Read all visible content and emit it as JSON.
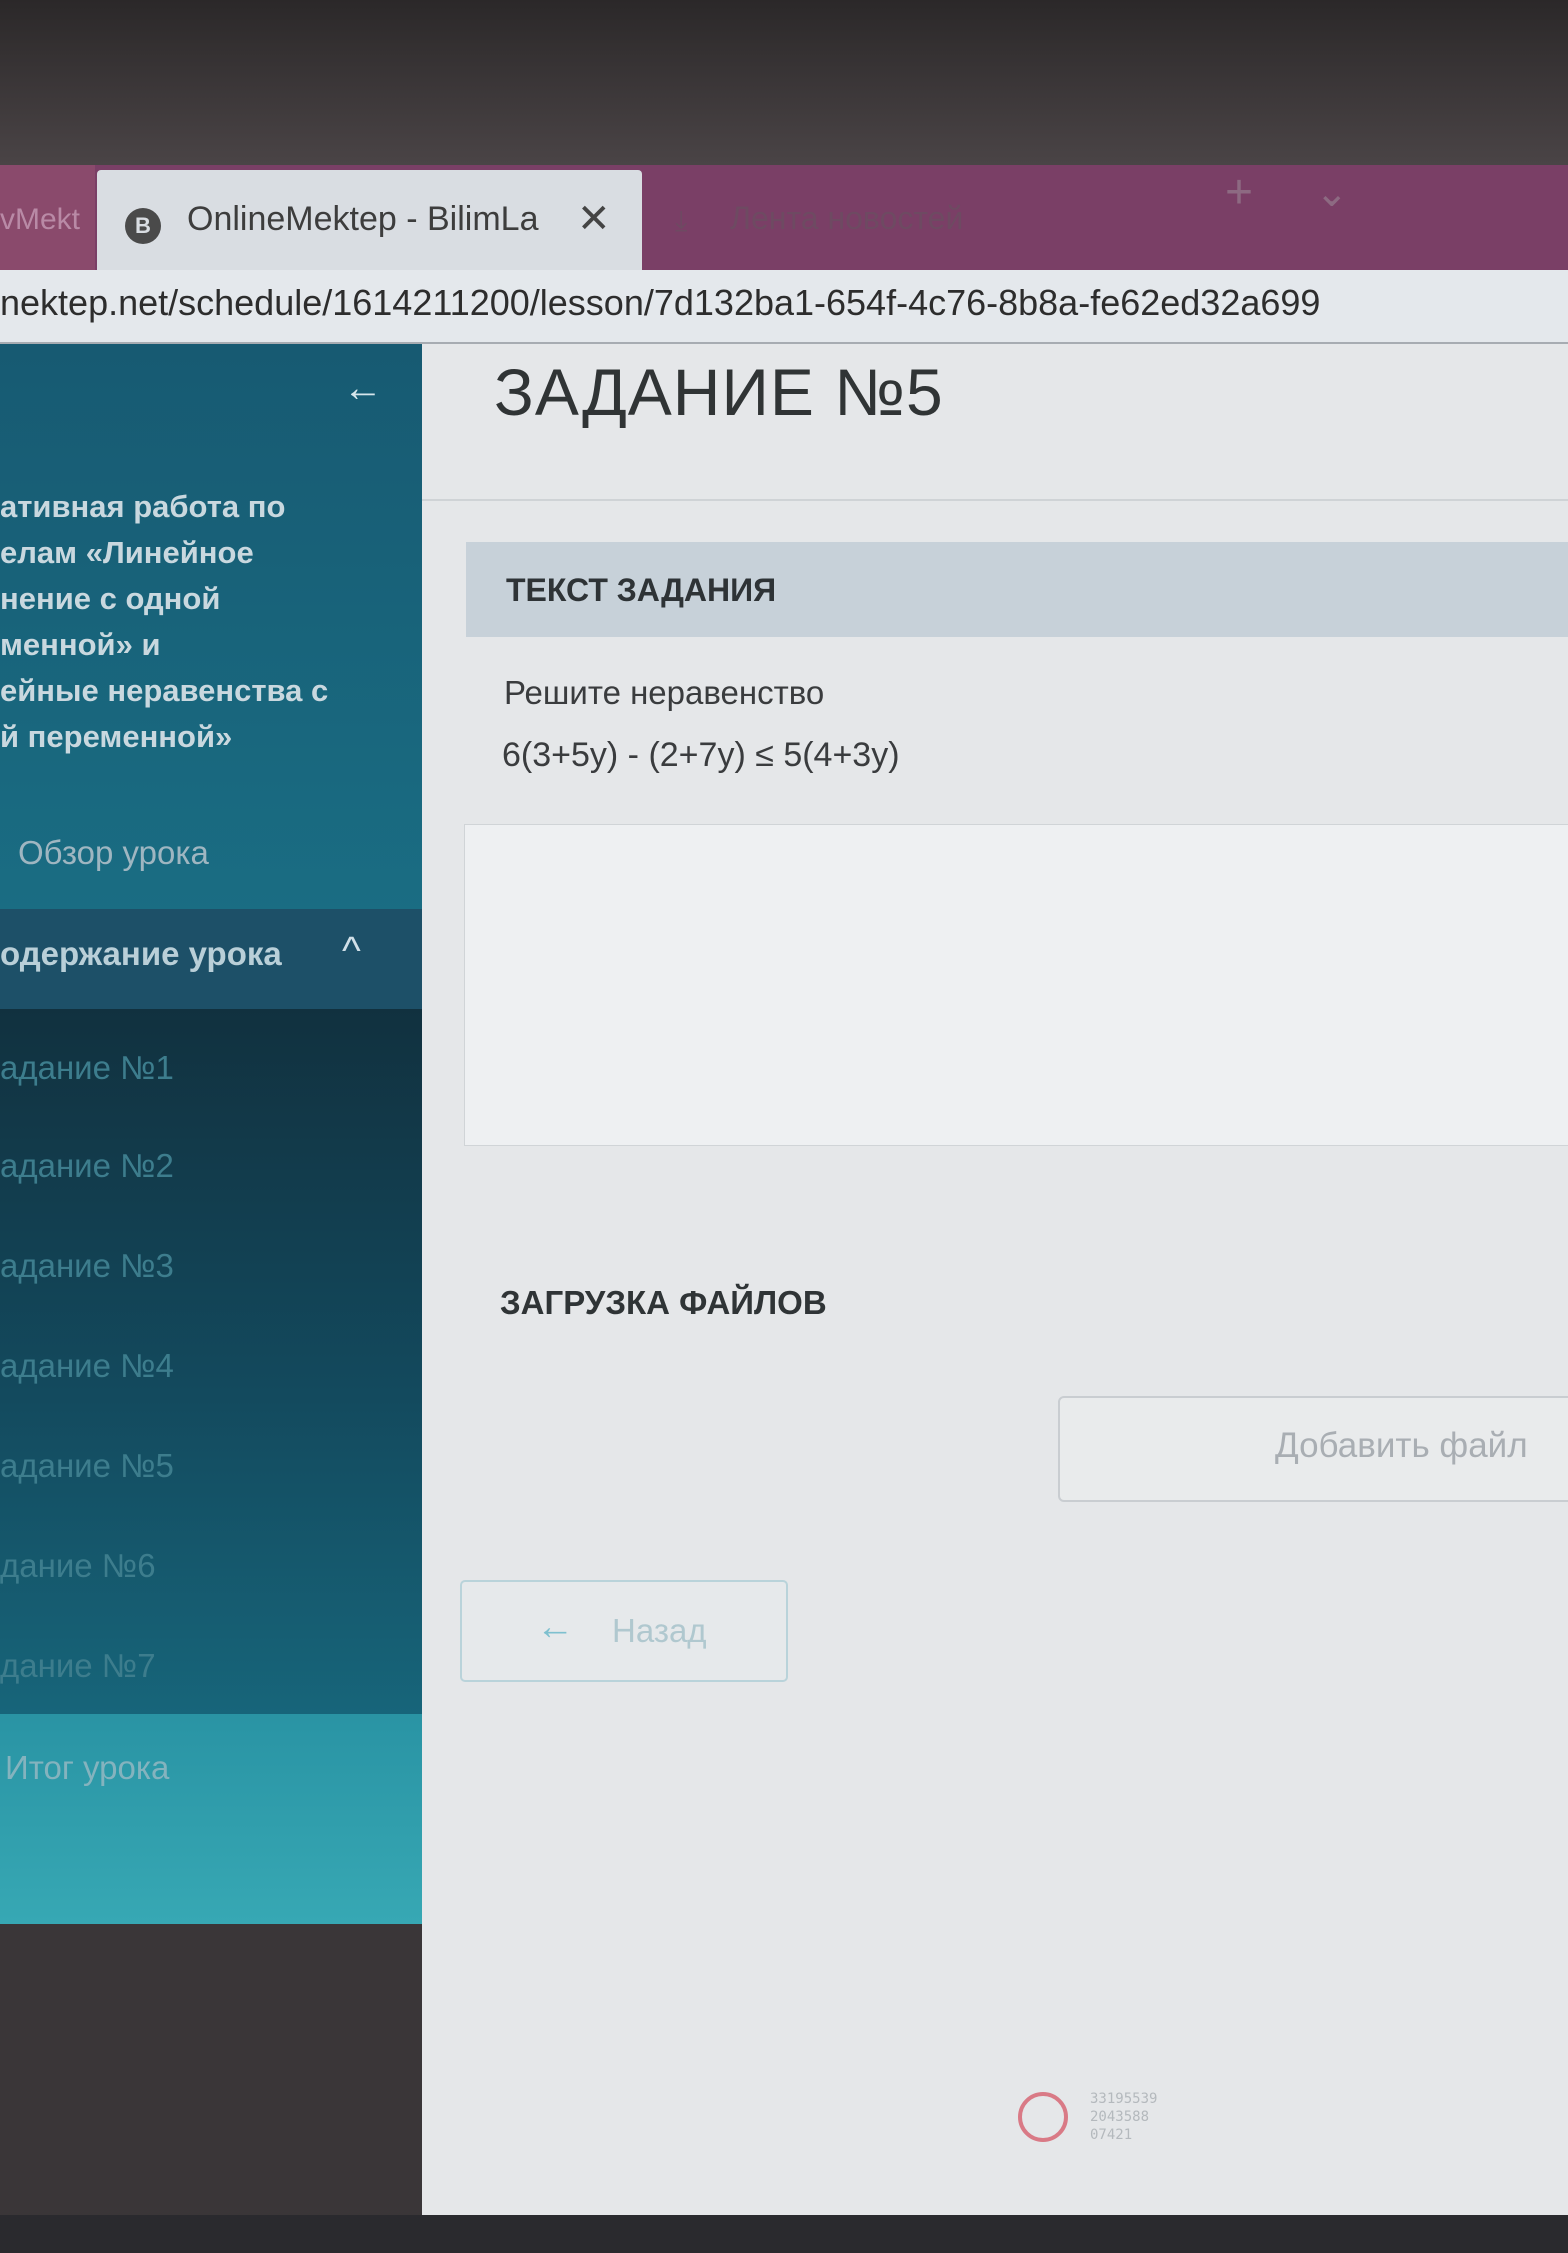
{
  "browser": {
    "prev_tab_label": "vMekt",
    "active_tab": {
      "favicon": "B",
      "title": "OnlineMektep - BilimLa",
      "close": "✕"
    },
    "other_tab": {
      "icon": "download-icon",
      "title": "Лента новостей"
    },
    "new_tab": "+",
    "tab_menu": "⌄",
    "url": "nektep.net/schedule/1614211200/lesson/7d132ba1-654f-4c76-8b8a-fe62ed32a699"
  },
  "sidebar": {
    "collapse_icon": "←",
    "course_title": "ативная работа по\nелам «Линейное\nнение с одной\nменной» и\nейные неравенства с\nй переменной»",
    "overview": "Обзор урока",
    "contents_label": "одержание урока",
    "contents_chevron": "^",
    "tasks": [
      "адание №1",
      "адание №2",
      "адание №3",
      "адание №4",
      "адание №5",
      "дание №6",
      "дание №7"
    ],
    "summary": "Итог урока"
  },
  "main": {
    "title": "ЗАДАНИЕ №5",
    "task_header": "ТЕКСТ ЗАДАНИЯ",
    "task_text": "Решите неравенство",
    "task_expression": "6(3+5y) - (2+7y) ≤ 5(4+3y)",
    "upload_header": "ЗАГРУЗКА ФАЙЛОВ",
    "add_file_label": "Добавить файл",
    "back_icon": "←",
    "back_label": "Назад"
  },
  "watermark": {
    "text": "33195539\n2043588\n07421"
  }
}
